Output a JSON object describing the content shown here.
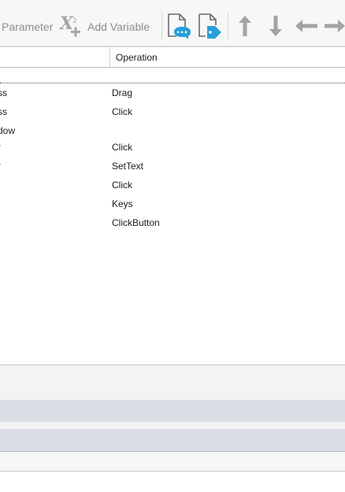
{
  "toolbar": {
    "parameter_label": "Parameter",
    "add_variable_label": "Add Variable",
    "icons": [
      "add-variable-icon",
      "comment-document-icon",
      "tag-document-icon",
      "move-up-icon",
      "move-down-icon",
      "move-left-icon",
      "move-right-icon"
    ],
    "colors": {
      "icon_gray": "#9a9a9a",
      "icon_blue": "#2a9fd8",
      "text_gray": "#8d8d8d"
    }
  },
  "grid": {
    "columns": [
      "",
      "Operation"
    ],
    "rows": [
      {
        "name": "ss",
        "operation": "Drag"
      },
      {
        "name": "ss",
        "operation": "Click"
      },
      {
        "name": "dow",
        "operation": ""
      },
      {
        "name": "r",
        "operation": "Click"
      },
      {
        "name": "r",
        "operation": "SetText"
      },
      {
        "name": "",
        "operation": "Click"
      },
      {
        "name": "",
        "operation": "Keys"
      },
      {
        "name": "",
        "operation": "ClickButton"
      }
    ]
  }
}
